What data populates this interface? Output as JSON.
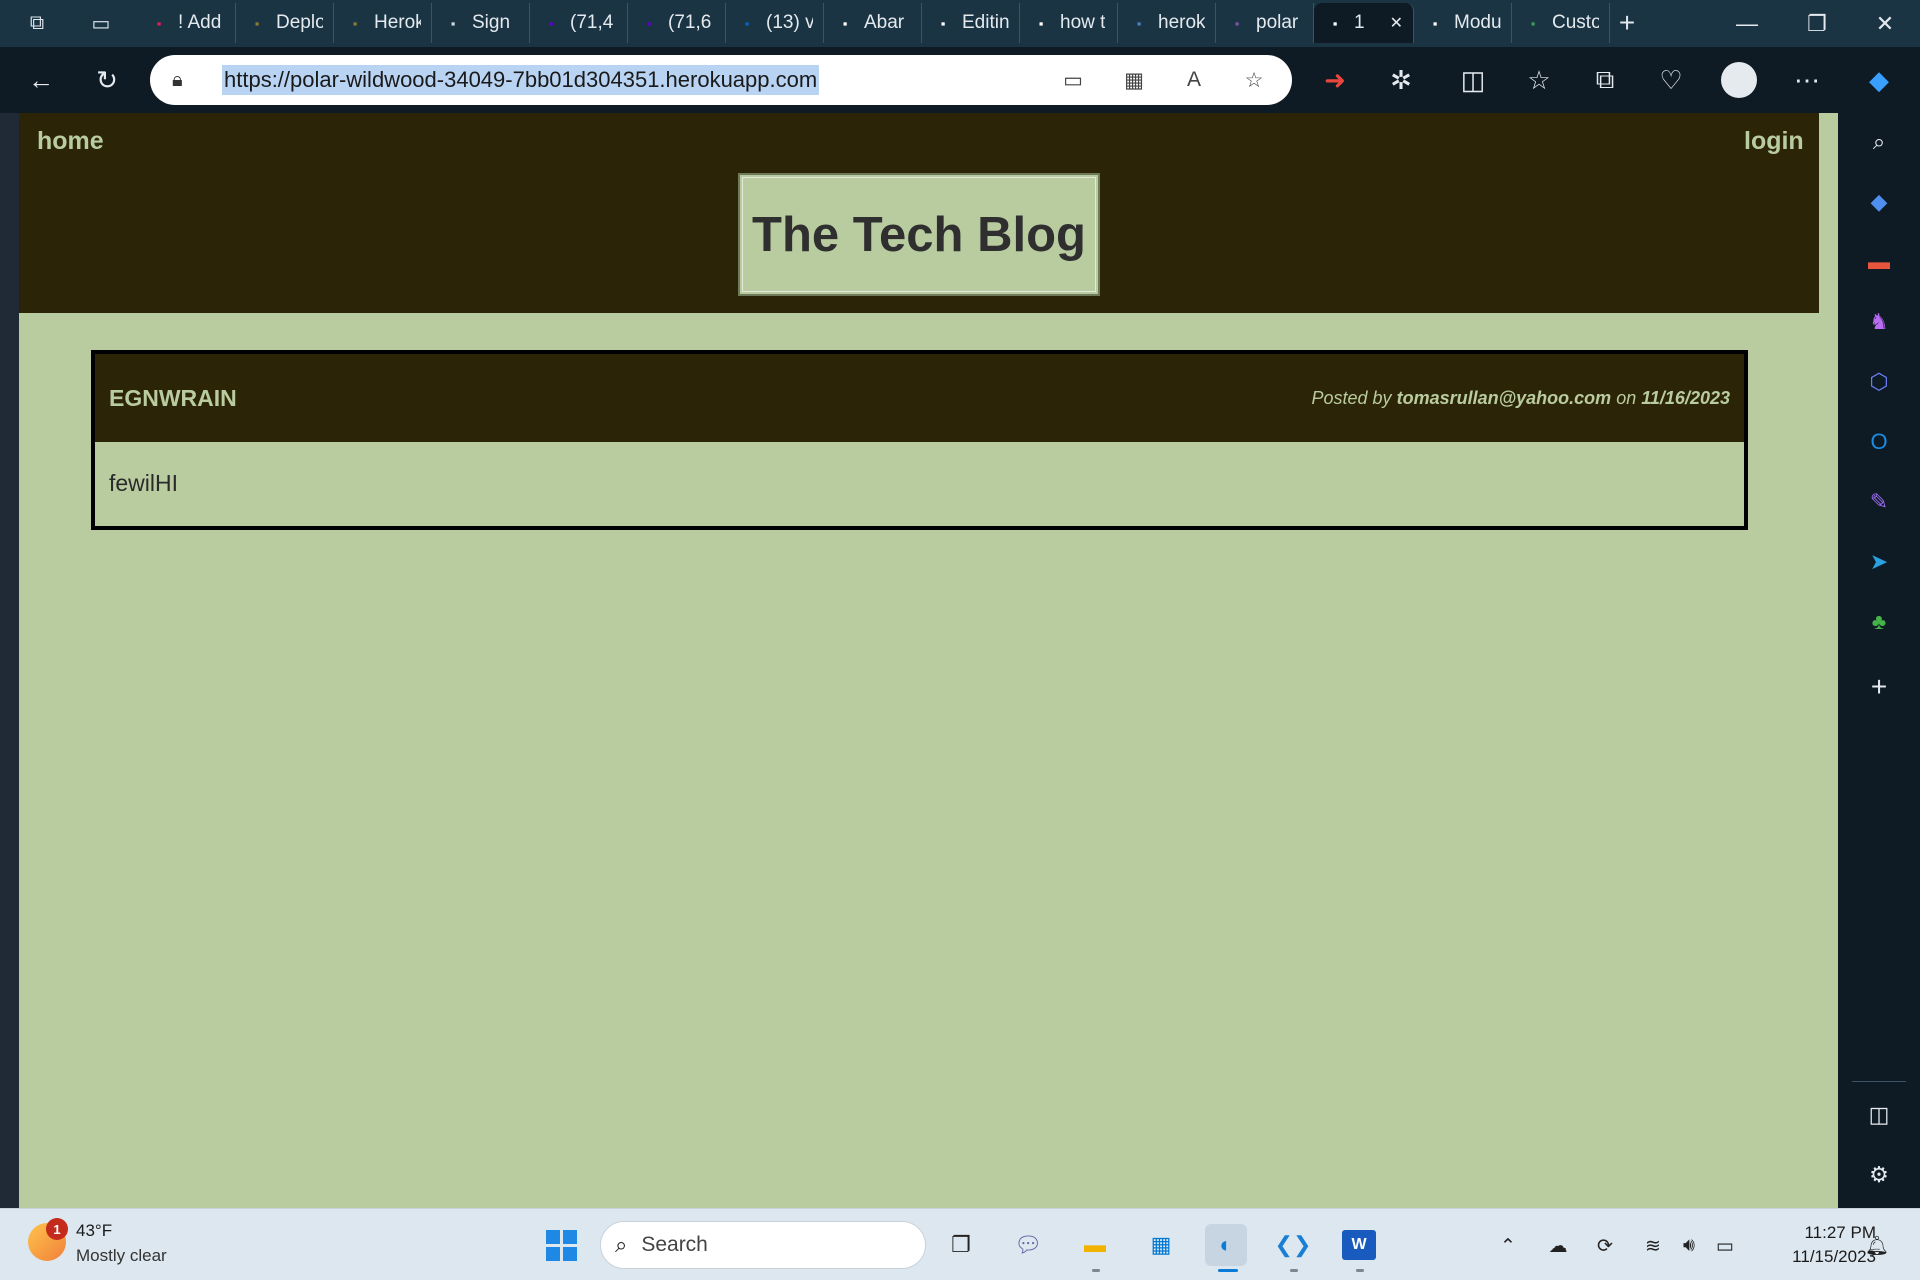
{
  "browser": {
    "tabs": [
      {
        "title": "! Add",
        "favicon": "slack-icon",
        "color": "#e01e5a"
      },
      {
        "title": "Deplo",
        "favicon": "fs-icon",
        "color": "#8a7a3a"
      },
      {
        "title": "Herok",
        "favicon": "fs-icon",
        "color": "#8a7a3a"
      },
      {
        "title": "Sign",
        "favicon": "page-icon",
        "color": "#cfd6dc"
      },
      {
        "title": "(71,4",
        "favicon": "yahoo-mail-icon",
        "color": "#6001d2"
      },
      {
        "title": "(71,6",
        "favicon": "yahoo-mail-icon",
        "color": "#6001d2"
      },
      {
        "title": "(13) v",
        "favicon": "linkedin-icon",
        "color": "#0a66c2"
      },
      {
        "title": "Abar",
        "favicon": "github-icon",
        "color": "#ffffff"
      },
      {
        "title": "Editin",
        "favicon": "github-icon",
        "color": "#ffffff"
      },
      {
        "title": "how t",
        "favicon": "google-icon",
        "color": "#ffffff"
      },
      {
        "title": "herok",
        "favicon": "search-icon",
        "color": "#4a7fc0"
      },
      {
        "title": "polar",
        "favicon": "heroku-icon",
        "color": "#79589f"
      },
      {
        "title": "1",
        "favicon": "page-icon",
        "color": "#ffffff",
        "active": true
      },
      {
        "title": "Modu",
        "favicon": "u-icon",
        "color": "#ffffff"
      },
      {
        "title": "Custo",
        "favicon": "spinner-icon",
        "color": "#3a9a5a"
      }
    ],
    "url": "https://polar-wildwood-34049-7bb01d304351.herokuapp.com"
  },
  "page": {
    "nav": {
      "home": "home",
      "login": "login"
    },
    "brand": "The Tech Blog",
    "post": {
      "title": "EGNWRAIN",
      "meta_prefix": "Posted by",
      "author": "tomasrullan@yahoo.com",
      "meta_on": "on",
      "date": "11/16/2023",
      "body": "fewilHI"
    },
    "colors": {
      "header_bg": "#2c2406",
      "page_bg": "#b9cca0",
      "accent": "#b9cca0"
    }
  },
  "taskbar": {
    "weather": {
      "badge": "1",
      "temp": "43°F",
      "condition": "Mostly clear"
    },
    "search_placeholder": "Search",
    "time": "11:27 PM",
    "date": "11/15/2023"
  }
}
